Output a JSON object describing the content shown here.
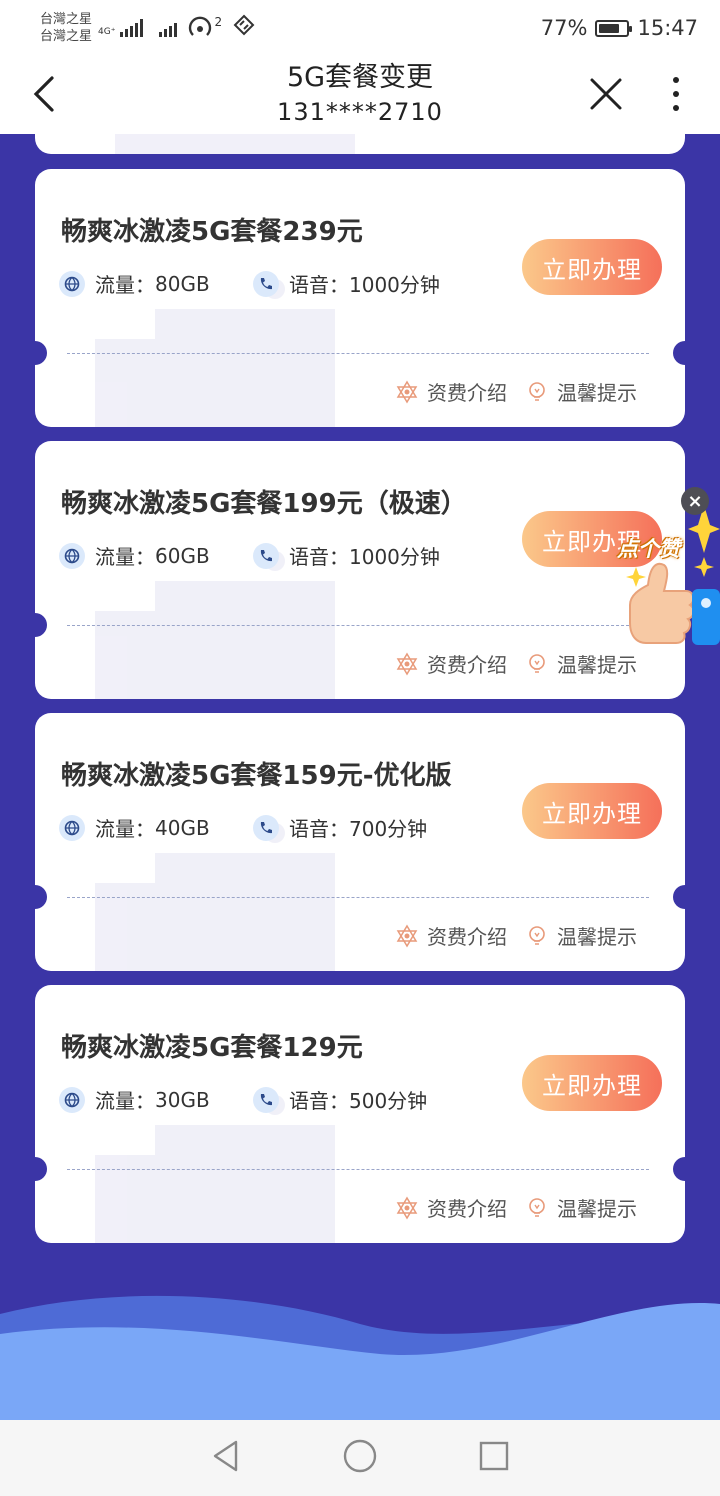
{
  "status_bar": {
    "carrier1": "台灣之星",
    "carrier2": "台灣之星",
    "network": "4G⁺",
    "hotspot_count": "2",
    "battery": "77%",
    "time": "15:47"
  },
  "nav": {
    "title": "5G套餐变更",
    "subtitle": "131****2710"
  },
  "plans": [
    {
      "title": "畅爽冰激凌5G套餐239元",
      "flow_label": "流量：",
      "flow_value": "80GB",
      "voice_label": "语音：",
      "voice_value": "1000分钟",
      "button": "立即办理",
      "fee_link": "资费介绍",
      "tip_link": "温馨提示"
    },
    {
      "title": "畅爽冰激凌5G套餐199元（极速）",
      "flow_label": "流量：",
      "flow_value": "60GB",
      "voice_label": "语音：",
      "voice_value": "1000分钟",
      "button": "立即办理",
      "fee_link": "资费介绍",
      "tip_link": "温馨提示"
    },
    {
      "title": "畅爽冰激凌5G套餐159元-优化版",
      "flow_label": "流量：",
      "flow_value": "40GB",
      "voice_label": "语音：",
      "voice_value": "700分钟",
      "button": "立即办理",
      "fee_link": "资费介绍",
      "tip_link": "温馨提示"
    },
    {
      "title": "畅爽冰激凌5G套餐129元",
      "flow_label": "流量：",
      "flow_value": "30GB",
      "voice_label": "语音：",
      "voice_value": "500分钟",
      "button": "立即办理",
      "fee_link": "资费介绍",
      "tip_link": "温馨提示"
    }
  ],
  "like_badge": {
    "text": "点个赞",
    "close": "×"
  },
  "colors": {
    "background": "#3b35a6",
    "button_start": "#fbc88a",
    "button_end": "#f5705a",
    "wave_light": "#78a6f7"
  }
}
